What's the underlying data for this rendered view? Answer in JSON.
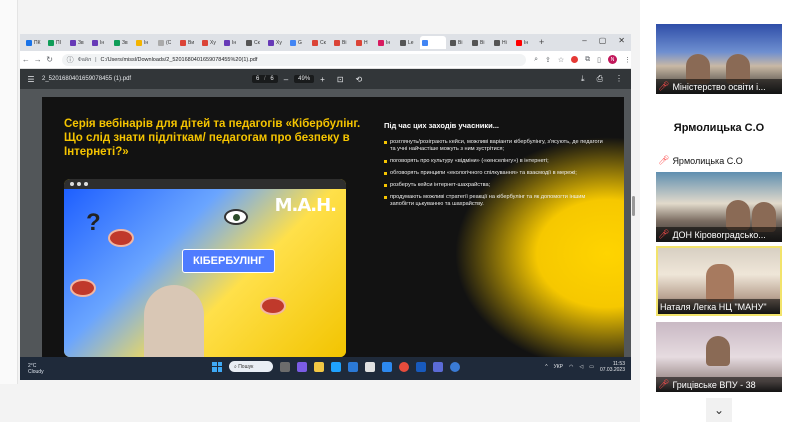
{
  "browser": {
    "tabs": [
      {
        "label": "ПК",
        "color": "#1a73e8"
      },
      {
        "label": "ПІ",
        "color": "#0f9d58"
      },
      {
        "label": "Зв",
        "color": "#673ab7"
      },
      {
        "label": "Ін",
        "color": "#673ab7"
      },
      {
        "label": "Зв",
        "color": "#0f9d58"
      },
      {
        "label": "Ін",
        "color": "#f4b400"
      },
      {
        "label": "(С",
        "color": "#aaaaaa"
      },
      {
        "label": "Ви",
        "color": "#db4437"
      },
      {
        "label": "Xy",
        "color": "#db4437"
      },
      {
        "label": "Ін",
        "color": "#673ab7"
      },
      {
        "label": "Ск",
        "color": "#555555"
      },
      {
        "label": "Xy",
        "color": "#673ab7"
      },
      {
        "label": "G",
        "color": "#4285f4"
      },
      {
        "label": "Ск",
        "color": "#db4437"
      },
      {
        "label": "Ві",
        "color": "#db4437"
      },
      {
        "label": "Н",
        "color": "#db4437"
      },
      {
        "label": "Ін",
        "color": "#d81b60"
      },
      {
        "label": "Le",
        "color": "#555555"
      },
      {
        "label": "",
        "color": "#4285f4",
        "active": true
      },
      {
        "label": "Ві",
        "color": "#555555"
      },
      {
        "label": "Ві",
        "color": "#555555"
      },
      {
        "label": "Hi",
        "color": "#555555"
      },
      {
        "label": "Ін",
        "color": "#ff0000"
      }
    ],
    "new_tab": "+",
    "address_label": "Файл",
    "url": "C:/Users/missl/Downloads/2_5201680401659078455%20(1).pdf",
    "profile_initial": "N"
  },
  "pdf": {
    "filename": "2_5201680401659078455 (1).pdf",
    "page_current": "6",
    "page_total": "6",
    "zoom": "49%"
  },
  "slide": {
    "title": "Серія вебінарів для дітей та педагогів «Кібербулінг. Що слід знати підліткам/ педагогам про безпеку в Інтернеті?»",
    "subtitle": "Під час цих заходів учасники...",
    "bullets": [
      "розглянуть/розіграють кейси, можливі варіанти кібербулінгу, з'ясують, де педагоги та учні найчастіше можуть з ним зустрітися;",
      "поговорять про культуру «відміни» («кенселінгу») в інтернеті;",
      "обговорять принципи «екологічного спілкування» та взаємодії в мережі;",
      "розберуть кейси інтернет-шахрайства;",
      "продумають можливі стратегії реакції на кібербулінг та як допомогти іншим запобігти цькуванню та шахрайству."
    ],
    "card_label": "КІБЕРБУЛІНГ",
    "brand": "М.А.Н."
  },
  "taskbar": {
    "weather_temp": "2°C",
    "weather_desc": "Cloudy",
    "search": "Пошук",
    "lang": "УКР",
    "time": "11:53",
    "date": "07.03.2023"
  },
  "participants": [
    {
      "name": "Міністерство освіти і...",
      "muted": true,
      "style": "room1"
    },
    {
      "name": "Ярмолицька С.О",
      "muted": true,
      "style": "text"
    },
    {
      "name": "ДОН Кіровоградсько...",
      "muted": true,
      "style": "room2"
    },
    {
      "name": "Наталя Легка НЦ \"МАНУ\"",
      "muted": false,
      "style": "room3"
    },
    {
      "name": "Грицівське ВПУ - 38",
      "muted": true,
      "style": "room4"
    }
  ],
  "avatar_text": "Ярмолицька С.О"
}
